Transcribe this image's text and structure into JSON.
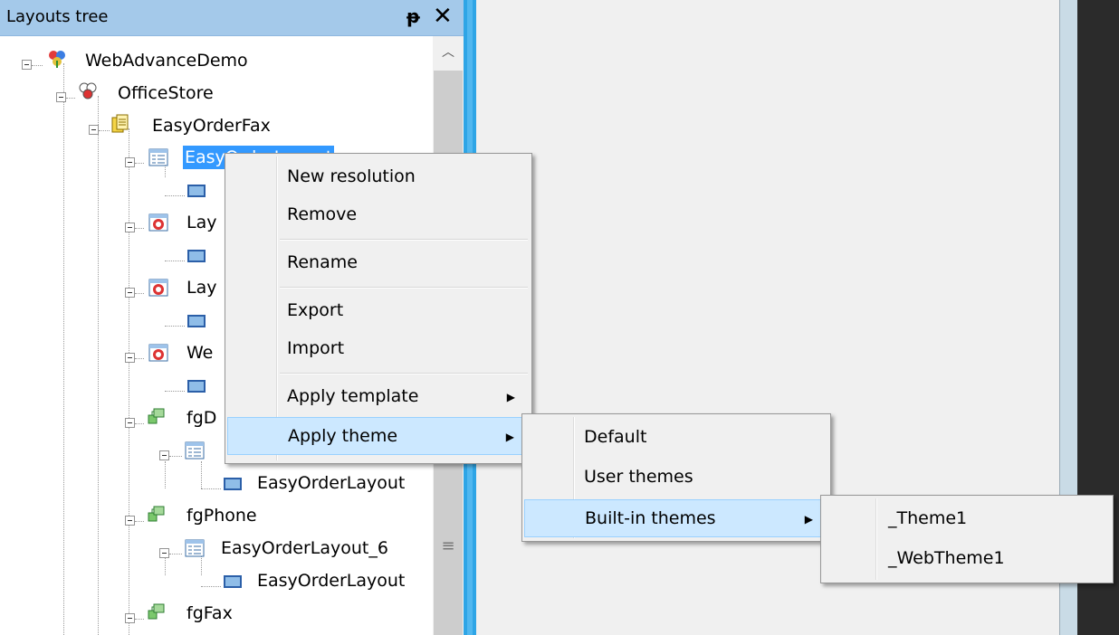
{
  "panel": {
    "title": "Layouts tree",
    "pin_icon": "pin-icon",
    "close_icon": "close-icon"
  },
  "tree": {
    "root": "WebAdvanceDemo",
    "app": "OfficeStore",
    "form": "EasyOrderFax",
    "selected_layout": "EasyOrderLayout",
    "layout_2": "Lay",
    "layout_3": "Lay",
    "layout_4": "We",
    "fg_desktop": "fgD",
    "fg_desktop_child": "EasyOrderLayout",
    "fg_phone": "fgPhone",
    "fg_phone_layout": "EasyOrderLayout_6",
    "fg_phone_child": "EasyOrderLayout",
    "fg_fax": "fgFax"
  },
  "context_menu": {
    "items": [
      {
        "label": "New resolution"
      },
      {
        "label": "Remove"
      },
      {
        "label": "Rename"
      },
      {
        "label": "Export"
      },
      {
        "label": "Import"
      },
      {
        "label": "Apply template",
        "has_submenu": true
      },
      {
        "label": "Apply theme",
        "has_submenu": true,
        "highlighted": true
      }
    ]
  },
  "theme_menu": {
    "items": [
      {
        "label": "Default"
      },
      {
        "label": "User themes"
      },
      {
        "label": "Built-in themes",
        "has_submenu": true,
        "highlighted": true
      }
    ]
  },
  "builtin_menu": {
    "items": [
      {
        "label": "_Theme1"
      },
      {
        "label": "_WebTheme1"
      }
    ]
  },
  "colors": {
    "header": "#a4c9ea",
    "selection": "#3399ff",
    "menu_highlight": "#cce8ff",
    "splitter": "#2ea5e6"
  }
}
